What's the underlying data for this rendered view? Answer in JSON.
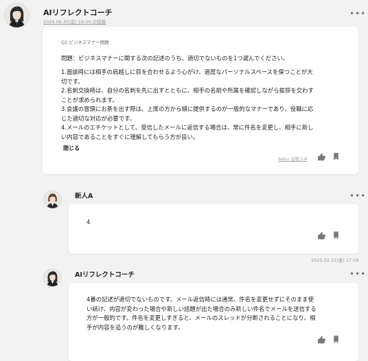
{
  "messages": [
    {
      "sender": "AIリフレクトコーチ",
      "meta": "2024.08.30(金) 16:00 の投稿",
      "menu_icon": "more-horizontal-icon",
      "card_title": "Q2.ビジネスマナー問題",
      "question": "問題：ビジネスマナーに関する次の記述のうち、適切でないものを1つ選んでください。",
      "choices": "1.面談時には相手の肩越しに目を合わせるよう心がけ、適度なパーソナルスペースを保つことが大\n切です。\n2.名刺交換時は、自分の名刺を先に出すとともに、相手の名前や所属を確認しながら挨拶を交わす\nことが求められます。\n3.会議の冒頭にお茶を出す際は、上席の方から順に提供するのが一般的なマナーであり、役職に応\nじた適切な対応が必要です。\n4.メールのエチケットとして、受信したメールに返信する場合は、常に件名を変更し、相手に新し\nい内容であることをすぐに理解してもらう方が良い。",
      "close_label": "閉じる",
      "shared_label": "babu @新人A"
    },
    {
      "sender": "新人A",
      "body": "4",
      "timestamp": "2025.02.21(金) 17:58"
    },
    {
      "sender": "AIリフレクトコーチ",
      "body": "4番の記述が適切でないものです。メール返信時には通常、件名を変更せずにそのまま使\nい続け、内容が変わった場合や新しい話題が出た場合のみ新しい件名でメールを送信する\n方が一般的です。件名を変更しすぎると、メールのスレッドが分断されることになり、相\n手が内容を追うのが難しくなります。"
    }
  ],
  "icons": {
    "like": "thumbs-up-icon",
    "bookmark": "bookmark-icon",
    "menu": "more-horizontal-icon"
  },
  "colors": {
    "background": "#f2f2f2",
    "card": "#ffffff",
    "icon": "#7a7a7a",
    "meta_text": "#9a9a9a"
  }
}
